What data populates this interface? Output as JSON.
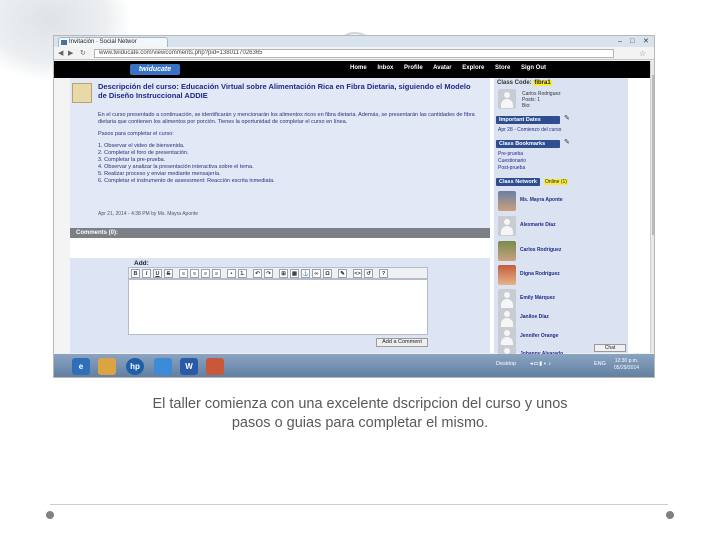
{
  "browser": {
    "tab_title": "Invitación · Social Networ",
    "url": "www.twiducate.com/viewcomments.php?pid=1380117026365",
    "controls": [
      "–",
      "□",
      "✕"
    ]
  },
  "site": {
    "logo": "twiducate",
    "nav": [
      "Home",
      "Inbox",
      "Profile",
      "Avatar",
      "Explore",
      "Store",
      "Sign Out"
    ]
  },
  "post": {
    "title": "Descripción del curso: Educación Virtual sobre Alimentación Rica en Fibra Dietaria, siguiendo el Modelo de Diseño Instruccional ADDIE",
    "paragraphs": [
      "En el curso presentado a continuación, se identificarán y mencionarán los alimentos ricos en fibra dietaria. Además, se presentarán las cantidades de fibra dietaria que contienen los alimentos por porción. Tienes la oportunidad de completar el curso en línea.",
      "Pasos para completar el curso:"
    ],
    "steps": [
      "1. Observar el video de bienvenida.",
      "2. Completar el foro de presentación.",
      "3. Completar la pre-prueba.",
      "4. Observar y analizar la presentación interactiva sobre el tema.",
      "5. Realizar proceso y enviar mediante mensajería.",
      "6. Completar el instrumento de assessment: Reacción escrita inmediata."
    ],
    "meta": "Apr 21, 2014 - 4:38 PM by Ms. Mayra Aponte"
  },
  "comments": {
    "header": "Comments (0):",
    "add_label": "Add:",
    "submit_label": "Add a Comment",
    "toolbar": [
      "B",
      "I",
      "U",
      "S",
      "≡",
      "≡",
      "≡",
      "≡",
      "•",
      "1.",
      "↶",
      "↷",
      "⊞",
      "▦",
      "⚓",
      "∞",
      "Ω",
      "✎",
      "<>",
      "↺",
      "?"
    ]
  },
  "sidebar": {
    "class_code_label": "Class Code:",
    "class_code": "fibra1",
    "teacher_name": "Carlos Rodriguez",
    "teacher_posts": "Posts: 1",
    "teacher_bio": "Bio:",
    "important_dates": "Important Dates",
    "important_date_item": "Apr 28 - Comienzo del curso",
    "bookmarks": "Class Bookmarks",
    "bookmark_items": [
      "Pre-prueba",
      "Cuestionario",
      "Post-prueba"
    ],
    "network": "Class Network",
    "network_badge": "Online (1)",
    "members": [
      {
        "name": "Ms. Mayra Aponte",
        "pic": "photo1"
      },
      {
        "name": "Alexmarie Díaz",
        "pic": "silh"
      },
      {
        "name": "Carlos Rodriguez",
        "pic": "photo2"
      },
      {
        "name": "Digna Rodríguez",
        "pic": "photo3"
      },
      {
        "name": "Emily Márquez",
        "pic": "silh"
      },
      {
        "name": "Janiloe Díaz",
        "pic": "silh"
      },
      {
        "name": "Jennifer Orange",
        "pic": "silh"
      },
      {
        "name": "Johanny Alvarado",
        "pic": "silh"
      }
    ],
    "chat_label": "Chat"
  },
  "taskbar": {
    "apps": [
      "e",
      "",
      "hp",
      "",
      "W",
      ""
    ],
    "desktop": "Desktop",
    "lang": "ENG",
    "time": "12:30 p.m.",
    "date": "05/29/2014"
  },
  "caption": {
    "line1": "El taller comienza con una excelente dscripcion del curso y unos",
    "line2": "pasos o guias para completar el mismo."
  }
}
